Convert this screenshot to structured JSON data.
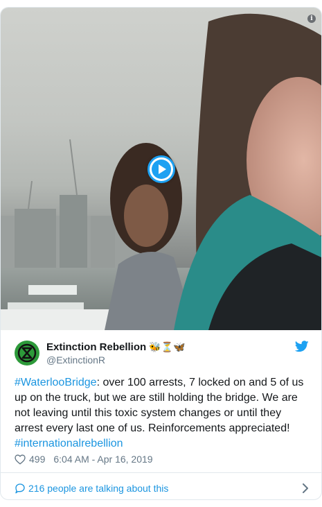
{
  "tweet": {
    "author": {
      "name": "Extinction Rebellion",
      "emojis": "🐝⏳🦋",
      "handle": "@ExtinctionR"
    },
    "text_parts": {
      "hashtag1": "#WaterlooBridge",
      "body": ": over 100 arrests, 7 locked on and 5 of us up on the truck, but we are still holding the bridge. We are not leaving until this toxic system changes or until they arrest every last one of us. Reinforcements appreciated!",
      "hashtag2": "#internationalrebellion"
    },
    "likes": "499",
    "timestamp": "6:04 AM - Apr 16, 2019",
    "talking": "216 people are talking about this"
  },
  "media": {
    "info_glyph": "i",
    "play_label": "Play video"
  },
  "colors": {
    "accent": "#1da1f2",
    "link": "#1b95e0",
    "muted": "#657786",
    "avatar_bg": "#2d9a3a"
  }
}
